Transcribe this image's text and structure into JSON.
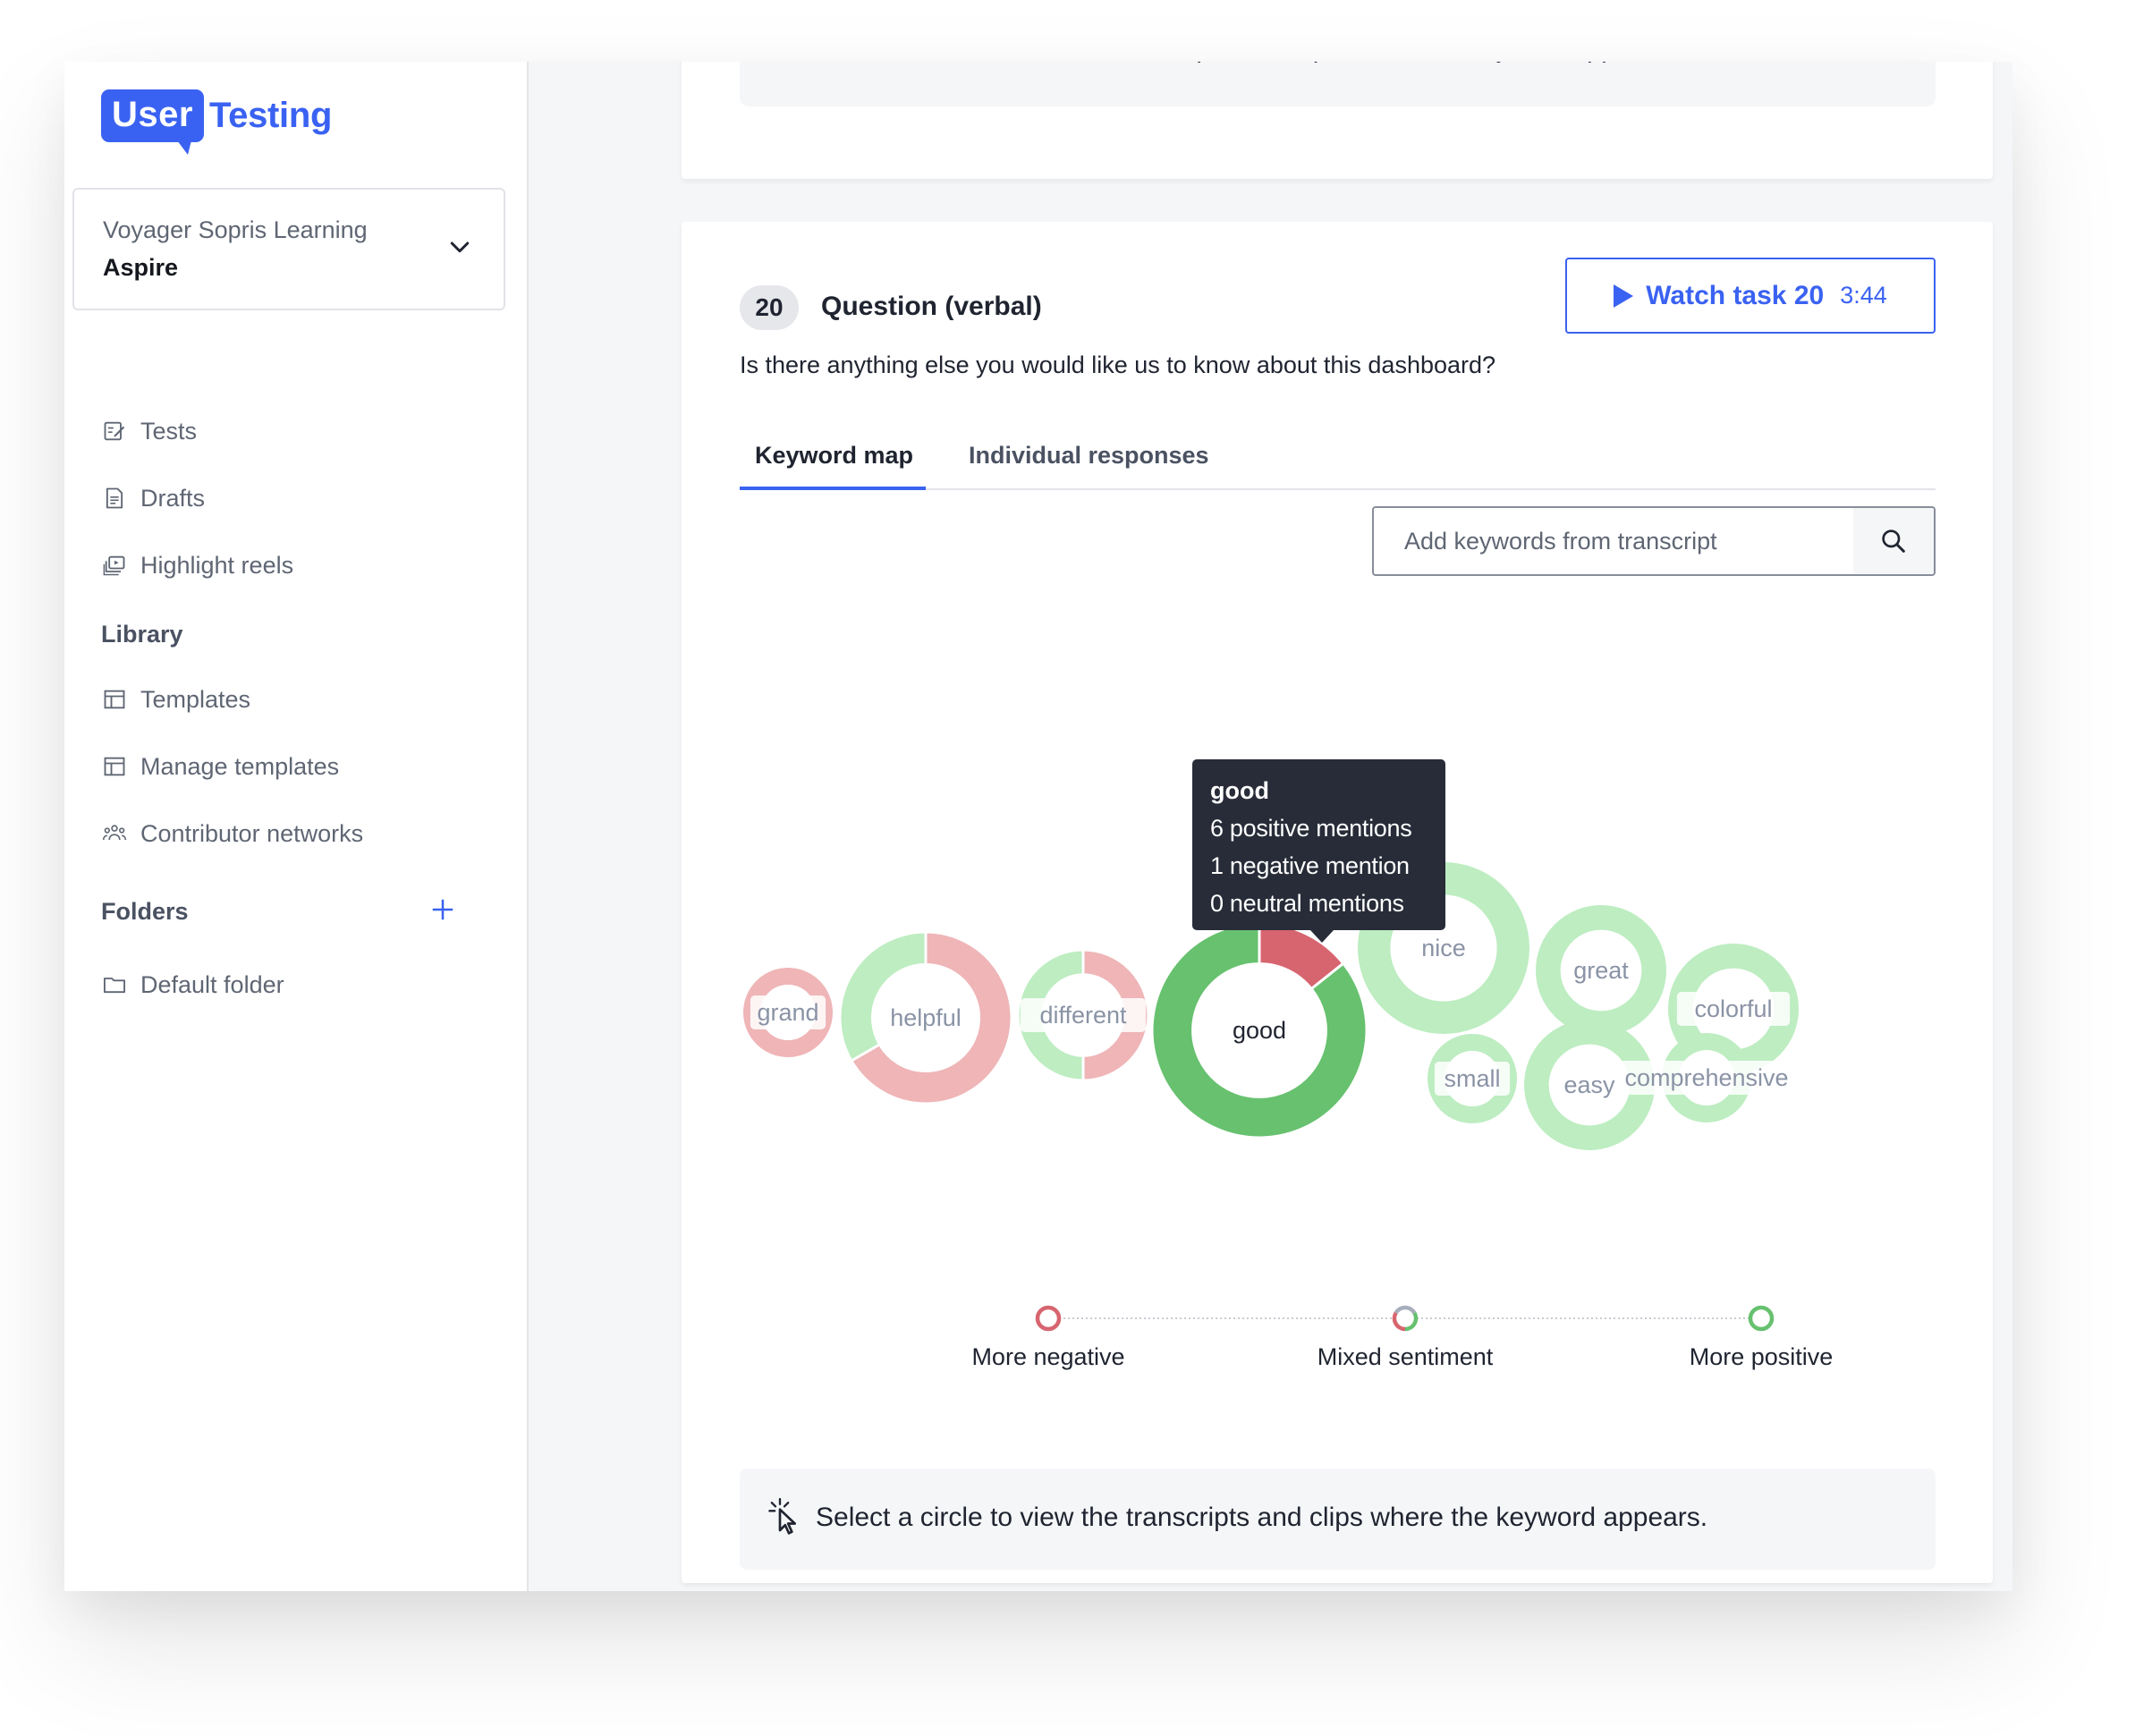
{
  "brand": {
    "logo_left": "User",
    "logo_right": "Testing",
    "accent": "#3a62f2"
  },
  "account": {
    "organization": "Voyager Sopris Learning",
    "project": "Aspire"
  },
  "sidebar": {
    "items": [
      {
        "label": "Tests",
        "icon": "tests-icon"
      },
      {
        "label": "Drafts",
        "icon": "drafts-icon"
      },
      {
        "label": "Highlight reels",
        "icon": "highlight-reels-icon"
      }
    ],
    "library_heading": "Library",
    "library_items": [
      {
        "label": "Templates",
        "icon": "templates-icon"
      },
      {
        "label": "Manage templates",
        "icon": "manage-templates-icon"
      },
      {
        "label": "Contributor networks",
        "icon": "contributor-networks-icon"
      }
    ],
    "folders_heading": "Folders",
    "folders": [
      {
        "label": "Default folder",
        "icon": "folder-icon"
      }
    ]
  },
  "previous_card": {
    "hint": "Select a circle to view the transcripts and clips where the keyword appears."
  },
  "question": {
    "number": "20",
    "type": "Question (verbal)",
    "text": "Is there anything else you would like us to know about this dashboard?",
    "watch_label": "Watch task 20",
    "watch_duration": "3:44"
  },
  "tabs": [
    {
      "label": "Keyword map",
      "active": true
    },
    {
      "label": "Individual responses",
      "active": false
    }
  ],
  "search": {
    "placeholder": "Add keywords from transcript",
    "value": ""
  },
  "tooltip": {
    "keyword": "good",
    "positive": "6 positive mentions",
    "negative": "1 negative mention",
    "neutral": "0 neutral mentions"
  },
  "colors": {
    "positive_strong": "#67c16f",
    "positive_light": "#bdedc1",
    "negative_strong": "#d76570",
    "negative_light": "#efb5b7",
    "neutral": "#a7aebb"
  },
  "chart_data": {
    "type": "bubble-donut",
    "title": "Keyword map",
    "keywords": [
      {
        "word": "grand",
        "positive": 0,
        "negative": 1,
        "neutral": 0,
        "size": 1,
        "highlighted": false
      },
      {
        "word": "helpful",
        "positive": 1,
        "negative": 2,
        "neutral": 0,
        "size": 3,
        "highlighted": false
      },
      {
        "word": "different",
        "positive": 1,
        "negative": 1,
        "neutral": 0,
        "size": 2,
        "highlighted": false
      },
      {
        "word": "good",
        "positive": 6,
        "negative": 1,
        "neutral": 0,
        "size": 7,
        "highlighted": true
      },
      {
        "word": "nice",
        "positive": 3,
        "negative": 0,
        "neutral": 0,
        "size": 3,
        "highlighted": false
      },
      {
        "word": "great",
        "positive": 2,
        "negative": 0,
        "neutral": 0,
        "size": 2,
        "highlighted": false
      },
      {
        "word": "colorful",
        "positive": 2,
        "negative": 0,
        "neutral": 0,
        "size": 2,
        "highlighted": false
      },
      {
        "word": "small",
        "positive": 1,
        "negative": 0,
        "neutral": 0,
        "size": 1,
        "highlighted": false
      },
      {
        "word": "easy",
        "positive": 2,
        "negative": 0,
        "neutral": 0,
        "size": 2,
        "highlighted": false
      },
      {
        "word": "comprehensive",
        "positive": 1,
        "negative": 0,
        "neutral": 0,
        "size": 1,
        "highlighted": false
      }
    ],
    "legend": [
      {
        "label": "More negative",
        "kind": "negative"
      },
      {
        "label": "Mixed sentiment",
        "kind": "mixed"
      },
      {
        "label": "More positive",
        "kind": "positive"
      }
    ]
  },
  "hint": {
    "text": "Select a circle to view the transcripts and clips where the keyword appears."
  }
}
